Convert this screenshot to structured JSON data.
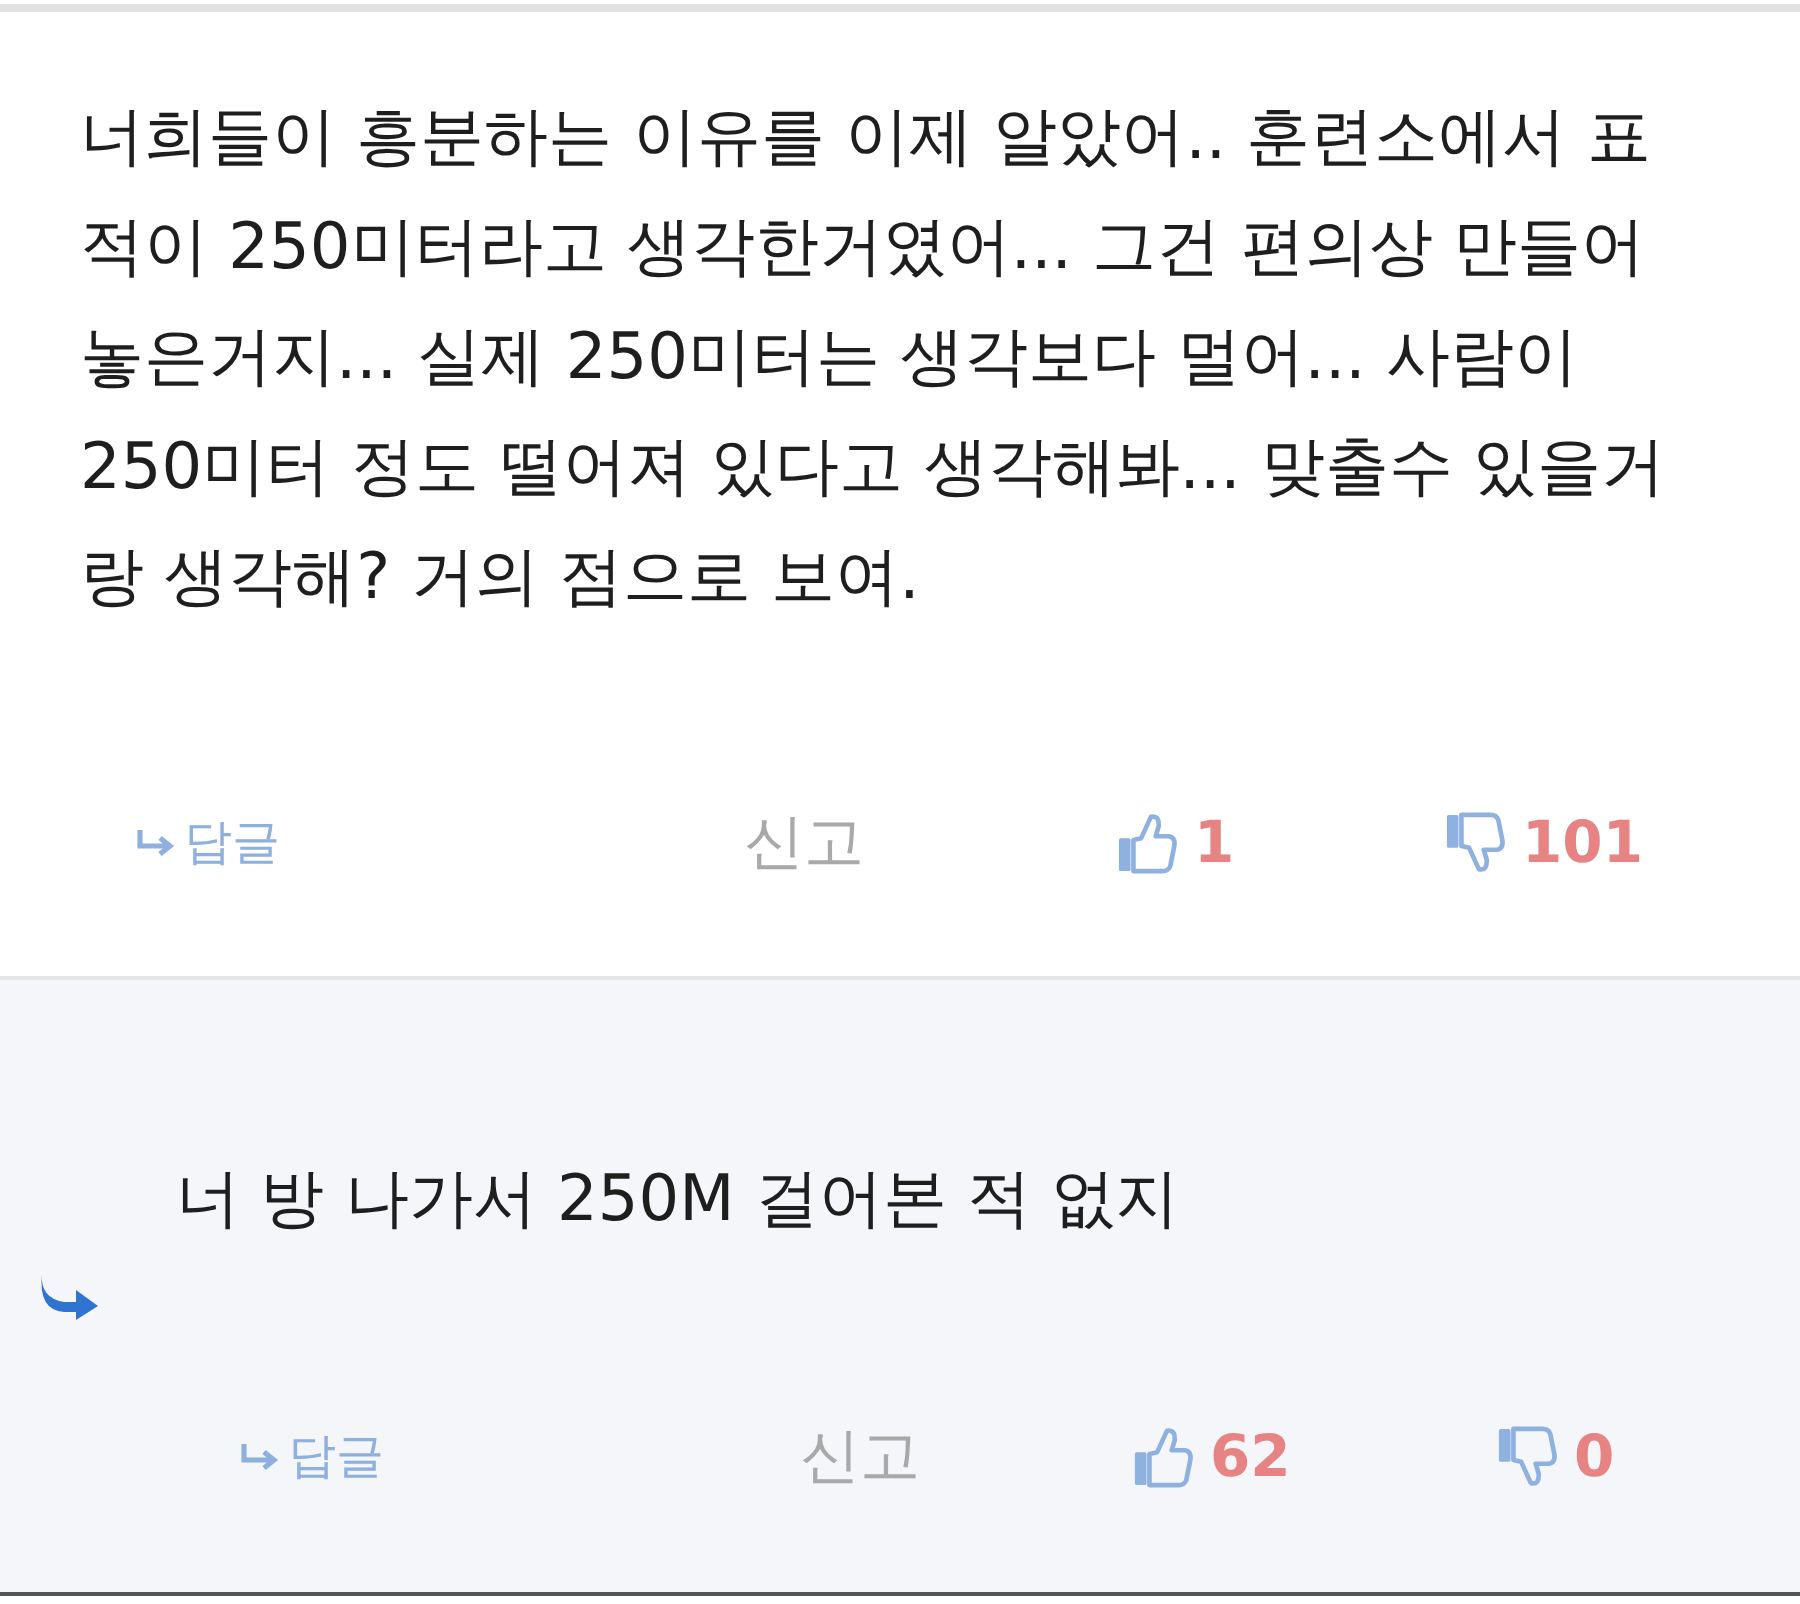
{
  "comments": [
    {
      "kind": "comment",
      "text": "너희들이 흥분하는 이유를 이제 알았어.. 훈련소에서 표적이 250미터라고 생각한거였어... 그건 편의상 만들어 놓은거지... 실제 250미터는 생각보다 멀어... 사람이 250미터 정도 떨어져 있다고 생각해봐... 맞출수 있을거랑 생각해? 거의 점으로 보여.",
      "actions": {
        "reply": "답글",
        "report": "신고",
        "likes": "1",
        "dislikes": "101"
      }
    },
    {
      "kind": "reply",
      "text": "너 방 나가서 250M 걸어본 적 없지",
      "actions": {
        "reply": "답글",
        "report": "신고",
        "likes": "62",
        "dislikes": "0"
      }
    }
  ]
}
